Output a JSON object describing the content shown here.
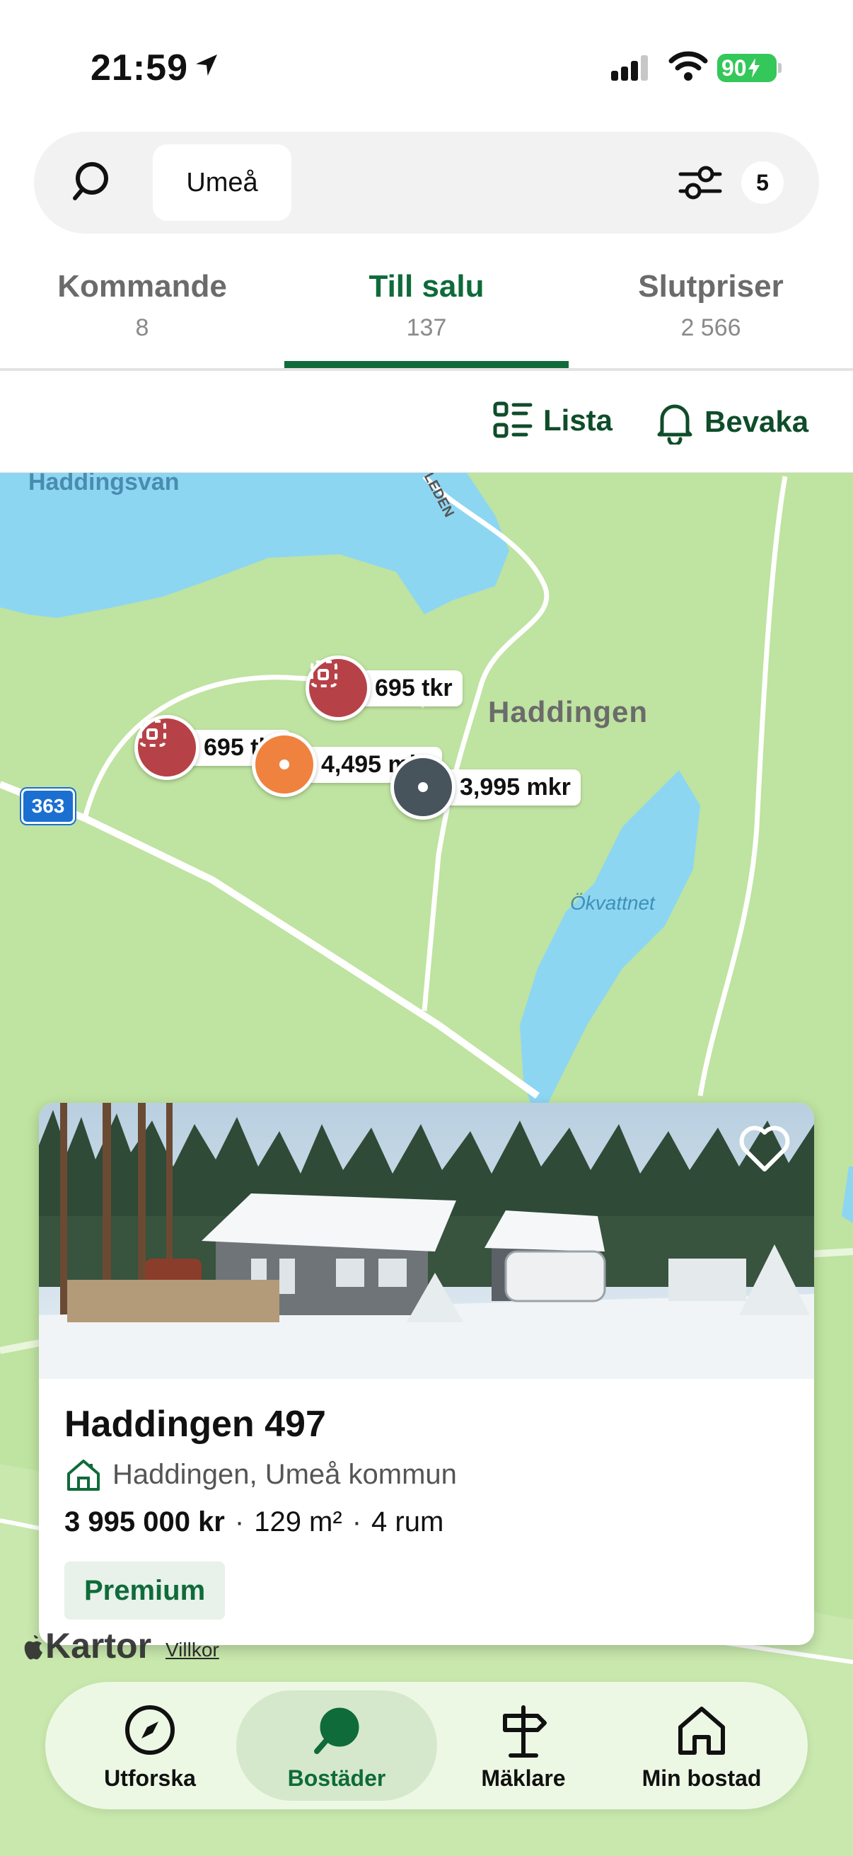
{
  "status_bar": {
    "time": "21:59",
    "battery": "90"
  },
  "search": {
    "location": "Umeå",
    "filter_count": "5"
  },
  "tabs": [
    {
      "label": "Kommande",
      "count": "8"
    },
    {
      "label": "Till salu",
      "count": "137"
    },
    {
      "label": "Slutpriser",
      "count": "2 566"
    }
  ],
  "active_tab": "Till salu",
  "actions": {
    "list_label": "Lista",
    "watch_label": "Bevaka"
  },
  "map": {
    "place_label": "Haddingen",
    "lake_label": "Ökvattnet",
    "road_number": "363",
    "road_name": "LEDEN",
    "top_cut_label": "Haddingsvan",
    "pins": [
      {
        "price": "695 tkr",
        "color": "#b64248",
        "type": "plot"
      },
      {
        "price": "695 tkr",
        "color": "#b64248",
        "type": "plot"
      },
      {
        "price": "4,495 mkr",
        "color": "#f0823f",
        "type": "house"
      },
      {
        "price": "3,995 mkr",
        "color": "#48545c",
        "type": "house"
      }
    ],
    "attribution": "Kartor",
    "terms": "Villkor"
  },
  "listing": {
    "title": "Haddingen 497",
    "location": "Haddingen, Umeå kommun",
    "price": "3 995 000 kr",
    "area": "129 m²",
    "rooms": "4 rum",
    "badge": "Premium"
  },
  "bottom_nav": [
    {
      "label": "Utforska",
      "icon": "compass-icon"
    },
    {
      "label": "Bostäder",
      "icon": "search-icon"
    },
    {
      "label": "Mäklare",
      "icon": "signpost-icon"
    },
    {
      "label": "Min bostad",
      "icon": "home-icon"
    }
  ],
  "colors": {
    "brand_green": "#0f6b3a",
    "map_green": "#bfe3a0",
    "water": "#8dd6f2"
  }
}
